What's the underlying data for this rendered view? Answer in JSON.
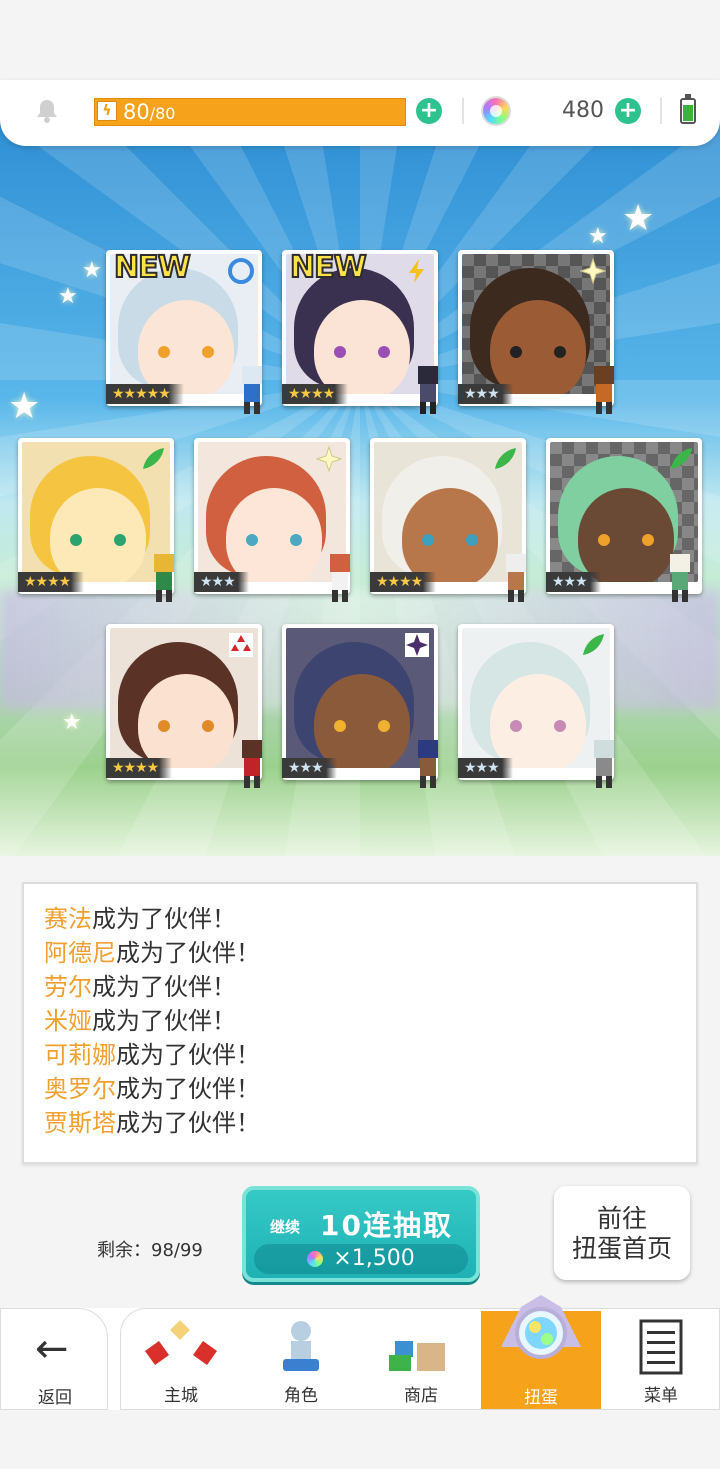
{
  "topbar": {
    "stamina_current": "80",
    "stamina_max": "/80",
    "stamina_fill": 1.0,
    "gems": "480"
  },
  "cards": [
    {
      "new": "NEW",
      "rarity": "★★★★★",
      "element": "circle-icon"
    },
    {
      "new": "NEW",
      "rarity": "★★★★",
      "element": "bolt-icon"
    },
    {
      "new": "",
      "rarity": "★★★",
      "element": "sparkle-icon"
    },
    {
      "new": "",
      "rarity": "★★★★",
      "element": "leaf-icon"
    },
    {
      "new": "",
      "rarity": "★★★",
      "element": "sparkle-icon"
    },
    {
      "new": "",
      "rarity": "★★★★",
      "element": "leaf-icon"
    },
    {
      "new": "",
      "rarity": "★★★",
      "element": "leaf-icon"
    },
    {
      "new": "",
      "rarity": "★★★★",
      "element": "diamond-icon"
    },
    {
      "new": "",
      "rarity": "★★★",
      "element": "dark-star-icon"
    },
    {
      "new": "",
      "rarity": "★★★",
      "element": "leaf-icon"
    }
  ],
  "log": [
    {
      "name": "赛法",
      "text": "成为了伙伴！"
    },
    {
      "name": "阿德尼",
      "text": "成为了伙伴！"
    },
    {
      "name": "劳尔",
      "text": "成为了伙伴！"
    },
    {
      "name": "米娅",
      "text": "成为了伙伴！"
    },
    {
      "name": "可莉娜",
      "text": "成为了伙伴！"
    },
    {
      "name": "奥罗尔",
      "text": "成为了伙伴！"
    },
    {
      "name": "贾斯塔",
      "text": "成为了伙伴！"
    }
  ],
  "remaining": "剩余：98/99",
  "pull_button": {
    "continue": "继续",
    "title": "10连抽取",
    "cost": "×1,500"
  },
  "goto_button": {
    "line1": "前往",
    "line2": "扭蛋首页"
  },
  "nav": {
    "back": "返回",
    "tabs": [
      "主城",
      "角色",
      "商店",
      "扭蛋",
      "菜单"
    ],
    "active": "扭蛋"
  }
}
